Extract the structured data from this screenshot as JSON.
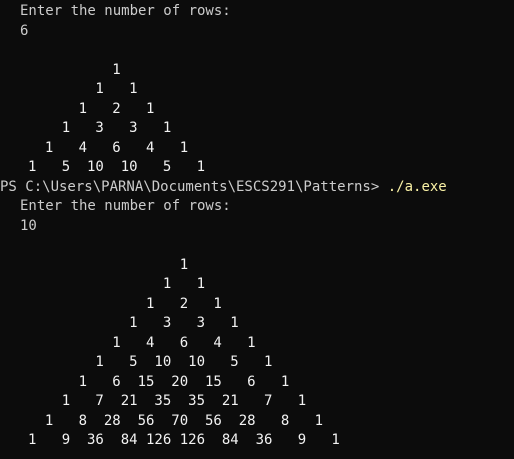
{
  "session1": {
    "prompt": "Enter the number of rows:",
    "input": "6",
    "rows": [
      "          1",
      "        1   1",
      "      1   2   1",
      "    1   3   3   1",
      "  1   4   6   4   1",
      "1   5  10  10   5   1"
    ]
  },
  "prompt_line": {
    "path": "PS C:\\Users\\PARNA\\Documents\\ESCS291\\Patterns> ",
    "command": "./a.exe"
  },
  "session2": {
    "prompt": "Enter the number of rows:",
    "input": "10",
    "rows": [
      "                  1",
      "                1   1",
      "              1   2   1",
      "            1   3   3   1",
      "          1   4   6   4   1",
      "        1   5  10  10   5   1",
      "      1   6  15  20  15   6   1",
      "    1   7  21  35  35  21   7   1",
      "  1   8  28  56  70  56  28   8   1",
      "1   9  36  84 126 126  84  36   9   1"
    ]
  }
}
